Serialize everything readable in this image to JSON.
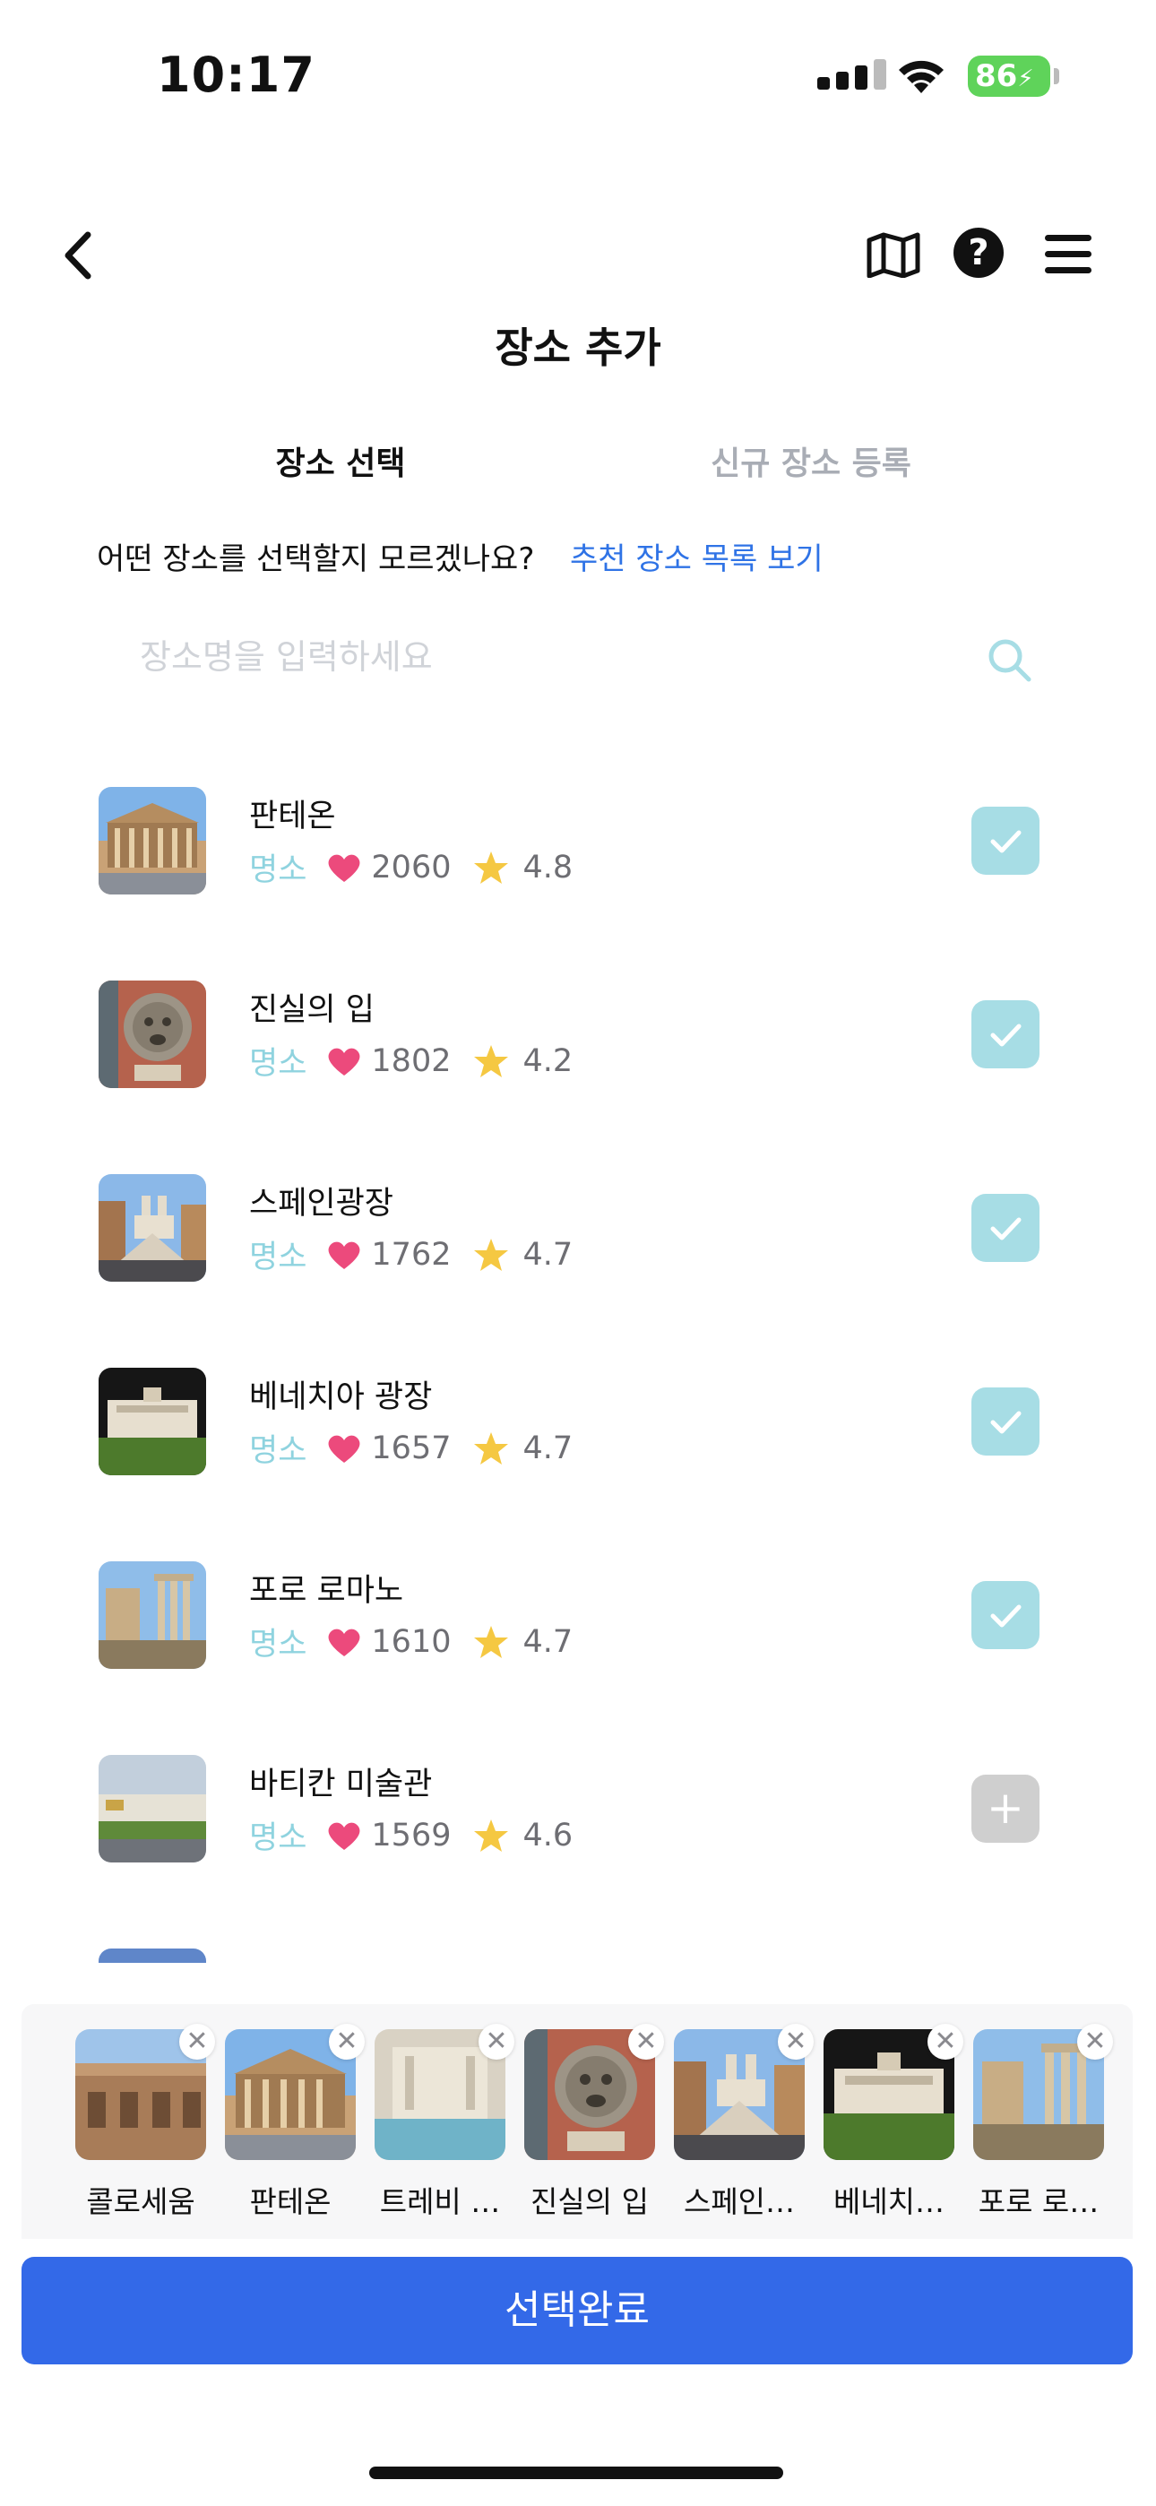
{
  "status": {
    "time": "10:17",
    "battery": "86"
  },
  "header": {
    "title": "장소 추가"
  },
  "tabs": [
    {
      "label": "장소 선택"
    },
    {
      "label": "신규 장소 등록"
    }
  ],
  "hint": {
    "text": "어떤 장소를 선택할지 모르겠나요?",
    "link": "추천 장소 목록 보기"
  },
  "search": {
    "placeholder": "장소명을 입력하세요"
  },
  "places": [
    {
      "name": "판테온",
      "category": "명소",
      "likes": "2060",
      "rating": "4.8",
      "selected": true
    },
    {
      "name": "진실의 입",
      "category": "명소",
      "likes": "1802",
      "rating": "4.2",
      "selected": true
    },
    {
      "name": "스페인광장",
      "category": "명소",
      "likes": "1762",
      "rating": "4.7",
      "selected": true
    },
    {
      "name": "베네치아 광장",
      "category": "명소",
      "likes": "1657",
      "rating": "4.7",
      "selected": true
    },
    {
      "name": "포로 로마노",
      "category": "명소",
      "likes": "1610",
      "rating": "4.7",
      "selected": true
    },
    {
      "name": "바티칸 미술관",
      "category": "명소",
      "likes": "1569",
      "rating": "4.6",
      "selected": false
    }
  ],
  "selected_chips": [
    {
      "label": "콜로세움"
    },
    {
      "label": "판테온"
    },
    {
      "label": "트레비 …"
    },
    {
      "label": "진실의 입"
    },
    {
      "label": "스페인…"
    },
    {
      "label": "베네치…"
    },
    {
      "label": "포로 로…"
    }
  ],
  "done_button": {
    "label": "선택완료"
  },
  "colors": {
    "accent": "#3369e8",
    "link": "#2f73e6",
    "check_bg": "#a7dde5",
    "category": "#8fd3df",
    "heart": "#ec4a7c",
    "star": "#f5c842"
  }
}
